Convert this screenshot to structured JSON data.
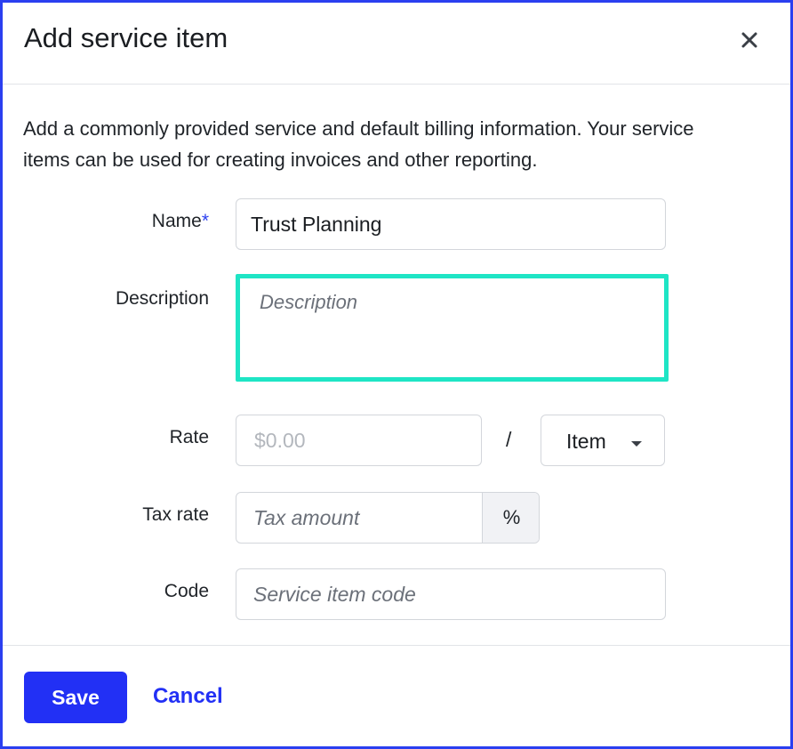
{
  "dialog": {
    "title": "Add service item",
    "close_icon": "close-icon",
    "intro": "Add a commonly provided service and default billing information. Your service items can be used for creating invoices and other reporting."
  },
  "form": {
    "name": {
      "label": "Name",
      "required_mark": "*",
      "value": "Trust Planning"
    },
    "description": {
      "label": "Description",
      "placeholder": "Description",
      "value": ""
    },
    "rate": {
      "label": "Rate",
      "placeholder": "$0.00",
      "separator": "/",
      "unit": "Item",
      "unit_icon": "chevron-down-icon"
    },
    "tax_rate": {
      "label": "Tax rate",
      "placeholder": "Tax amount",
      "suffix": "%"
    },
    "code": {
      "label": "Code",
      "placeholder": "Service item code"
    }
  },
  "footer": {
    "save_label": "Save",
    "cancel_label": "Cancel"
  },
  "colors": {
    "accent": "#2230f5",
    "focus_ring": "#1ee5c5",
    "frame": "#2b3ff0"
  }
}
